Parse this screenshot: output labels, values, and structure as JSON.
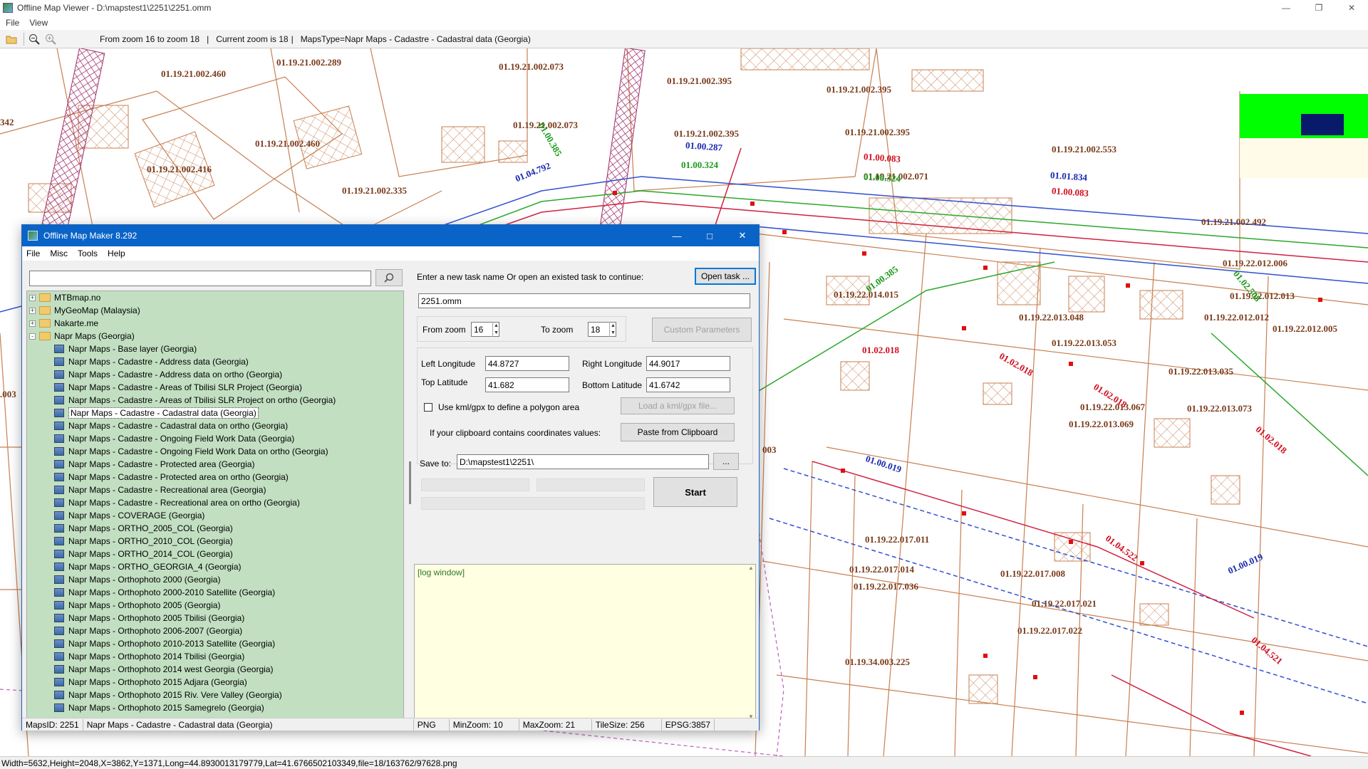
{
  "viewer": {
    "title": "Offline Map Viewer - D:\\mapstest1\\2251\\2251.omm",
    "menu": [
      "File",
      "View"
    ],
    "toolbar": {
      "zoom_range": "From zoom 16 to zoom 18",
      "current_zoom": "Current zoom is 18",
      "maps_type": "MapsType=Napr Maps - Cadastre - Cadastral data (Georgia)",
      "sep": "|"
    },
    "status": "Width=5632,Height=2048,X=3862,Y=1371,Long=44.8930013179779,Lat=41.6766502103349,file=18/163762/97628.png"
  },
  "map": {
    "parcels": [
      "01.19.21.002.289",
      "01.19.21.002.073",
      "01.19.21.002.460",
      "01.19.21.002.395",
      "01.19.21.002.395",
      "01.19.21.002.073",
      "01.19.21.002.395",
      "01.19.21.002.395",
      "01.19.21.002.460",
      "01.19.21.002.553",
      "01.19.21.002.416",
      "01.19.21.002.071",
      "01.19.21.002.335",
      "01.19.21.002.492",
      "01.19.22.012.006",
      "01.19.22.014.015",
      "01.19.22.012.013",
      "01.19.22.013.048",
      "01.19.22.012.012",
      "01.19.22.012.005",
      "01.19.22.013.053",
      "01.19.22.013.035",
      "01.19.22.013.067",
      "01.19.22.013.073",
      "01.19.22.013.069",
      "01.19.22.017.011",
      "01.19.22.017.014",
      "01.19.22.017.008",
      "01.19.22.017.036",
      "01.19.22.017.021",
      "01.19.22.017.022",
      "01.19.34.003.225",
      "342",
      ".003",
      "003"
    ],
    "roads_blue": [
      "01.00.287",
      "01.04.792",
      "01.01.834",
      "01.00.019",
      "01.00.019"
    ],
    "roads_green": [
      "01.00.324",
      "01.00.324",
      "01.00.385",
      "01.02.508",
      "01.00.385"
    ],
    "roads_red": [
      "01.00.083",
      "01.00.083",
      "01.02.018",
      "01.02.018",
      "01.02.018",
      "01.02.018",
      "01.04.522",
      "01.04.521"
    ]
  },
  "dialog": {
    "title": "Offline Map Maker 8.292",
    "menu": [
      "File",
      "Misc",
      "Tools",
      "Help"
    ],
    "search": {
      "value": ""
    },
    "tree": [
      {
        "label": "MTBmap.no",
        "type": "folder",
        "toggle": "+"
      },
      {
        "label": "MyGeoMap (Malaysia)",
        "type": "folder",
        "toggle": "+"
      },
      {
        "label": "Nakarte.me",
        "type": "folder",
        "toggle": "+"
      },
      {
        "label": "Napr Maps (Georgia)",
        "type": "folder",
        "toggle": "-"
      },
      {
        "label": "Napr Maps - Base layer (Georgia)",
        "type": "map"
      },
      {
        "label": "Napr Maps - Cadastre - Address data (Georgia)",
        "type": "map"
      },
      {
        "label": "Napr Maps - Cadastre - Address data on ortho (Georgia)",
        "type": "map"
      },
      {
        "label": "Napr Maps - Cadastre - Areas of Tbilisi SLR Project (Georgia)",
        "type": "map"
      },
      {
        "label": "Napr Maps - Cadastre - Areas of Tbilisi SLR Project on ortho (Georgia)",
        "type": "map"
      },
      {
        "label": "Napr Maps - Cadastre - Cadastral data (Georgia)",
        "type": "map",
        "selected": true
      },
      {
        "label": "Napr Maps - Cadastre - Cadastral data on ortho (Georgia)",
        "type": "map"
      },
      {
        "label": "Napr Maps - Cadastre - Ongoing Field Work Data (Georgia)",
        "type": "map"
      },
      {
        "label": "Napr Maps - Cadastre - Ongoing Field Work Data on ortho (Georgia)",
        "type": "map"
      },
      {
        "label": "Napr Maps - Cadastre - Protected area (Georgia)",
        "type": "map"
      },
      {
        "label": "Napr Maps - Cadastre - Protected area on ortho (Georgia)",
        "type": "map"
      },
      {
        "label": "Napr Maps - Cadastre - Recreational area (Georgia)",
        "type": "map"
      },
      {
        "label": "Napr Maps - Cadastre - Recreational area on ortho (Georgia)",
        "type": "map"
      },
      {
        "label": "Napr Maps - COVERAGE (Georgia)",
        "type": "map"
      },
      {
        "label": "Napr Maps - ORTHO_2005_COL (Georgia)",
        "type": "map"
      },
      {
        "label": "Napr Maps - ORTHO_2010_COL (Georgia)",
        "type": "map"
      },
      {
        "label": "Napr Maps - ORTHO_2014_COL (Georgia)",
        "type": "map"
      },
      {
        "label": "Napr Maps - ORTHO_GEORGIA_4 (Georgia)",
        "type": "map"
      },
      {
        "label": "Napr Maps - Orthophoto 2000 (Georgia)",
        "type": "map"
      },
      {
        "label": "Napr Maps - Orthophoto 2000-2010 Satellite (Georgia)",
        "type": "map"
      },
      {
        "label": "Napr Maps - Orthophoto 2005 (Georgia)",
        "type": "map"
      },
      {
        "label": "Napr Maps - Orthophoto 2005 Tbilisi (Georgia)",
        "type": "map"
      },
      {
        "label": "Napr Maps - Orthophoto 2006-2007 (Georgia)",
        "type": "map"
      },
      {
        "label": "Napr Maps - Orthophoto 2010-2013 Satellite (Georgia)",
        "type": "map"
      },
      {
        "label": "Napr Maps - Orthophoto 2014 Tbilisi (Georgia)",
        "type": "map"
      },
      {
        "label": "Napr Maps - Orthophoto 2014 west Georgia (Georgia)",
        "type": "map"
      },
      {
        "label": "Napr Maps - Orthophoto 2015 Adjara (Georgia)",
        "type": "map"
      },
      {
        "label": "Napr Maps - Orthophoto 2015 Riv. Vere Valley (Georgia)",
        "type": "map"
      },
      {
        "label": "Napr Maps - Orthophoto 2015 Samegrelo (Georgia)",
        "type": "map"
      }
    ],
    "task_prompt": "Enter a new task name Or open an existed task to continue:",
    "open_task_label": "Open task ...",
    "task_name": "2251.omm",
    "from_zoom_label": "From zoom",
    "from_zoom": "16",
    "to_zoom_label": "To zoom",
    "to_zoom": "18",
    "custom_params_label": "Custom Parameters",
    "left_lon_label": "Left Longitude",
    "left_lon": "44.8727",
    "right_lon_label": "Right Longitude",
    "right_lon": "44.9017",
    "top_lat_label": "Top Latitude",
    "top_lat": "41.682",
    "bottom_lat_label": "Bottom Latitude",
    "bottom_lat": "41.6742",
    "kml_label": "Use kml/gpx to define a polygon area",
    "load_kml_label": "Load a kml/gpx file...",
    "clipboard_prompt": "If your clipboard contains coordinates values:",
    "paste_label": "Paste from Clipboard",
    "save_to_label": "Save to:",
    "save_to": "D:\\mapstest1\\2251\\",
    "browse_label": "...",
    "start_label": "Start",
    "log_text": "[log window]",
    "status": {
      "maps_id": "MapsID: 2251",
      "maps_name": "Napr Maps - Cadastre - Cadastral data (Georgia)",
      "format": "PNG",
      "min_zoom": "MinZoom: 10",
      "max_zoom": "MaxZoom: 21",
      "tile_size": "TileSize: 256",
      "epsg": "EPSG:3857"
    }
  }
}
